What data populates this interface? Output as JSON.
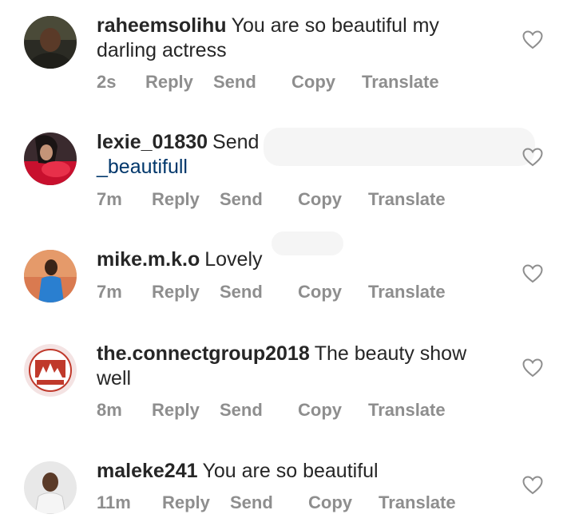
{
  "comments": [
    {
      "username": "raheemsolihu",
      "text": "You are so beautiful my darling actress",
      "time": "2s",
      "actions": {
        "reply": "Reply",
        "send": "Send",
        "copy": "Copy",
        "translate": "Translate"
      },
      "avatar_icon": "profile-photo"
    },
    {
      "username": "lexie_01830",
      "text": "Send",
      "mention": "_beautifull",
      "time": "7m",
      "actions": {
        "reply": "Reply",
        "send": "Send",
        "copy": "Copy",
        "translate": "Translate"
      },
      "avatar_icon": "profile-photo"
    },
    {
      "username": "mike.m.k.o",
      "text": "Lovely",
      "time": "7m",
      "actions": {
        "reply": "Reply",
        "send": "Send",
        "copy": "Copy",
        "translate": "Translate"
      },
      "avatar_icon": "profile-photo"
    },
    {
      "username": "the.connectgroup2018",
      "text": "The beauty show well",
      "time": "8m",
      "actions": {
        "reply": "Reply",
        "send": "Send",
        "copy": "Copy",
        "translate": "Translate"
      },
      "avatar_icon": "group-logo"
    },
    {
      "username": "maleke241",
      "text": "You are so beautiful",
      "time": "11m",
      "actions": {
        "reply": "Reply",
        "send": "Send",
        "copy": "Copy",
        "translate": "Translate"
      },
      "avatar_icon": "profile-photo"
    }
  ],
  "colors": {
    "text": "#262626",
    "meta": "#8e8e8e",
    "mention": "#00376b",
    "heart_outline": "#8e8e8e"
  },
  "icons": {
    "like": "heart-outline-icon"
  }
}
